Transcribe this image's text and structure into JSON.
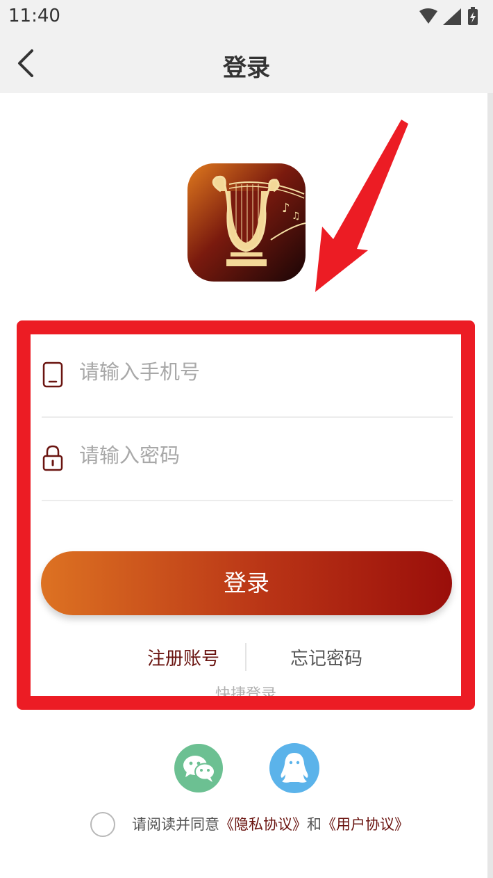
{
  "status_bar": {
    "time": "11:40"
  },
  "nav": {
    "title": "登录"
  },
  "form": {
    "phone_placeholder": "请输入手机号",
    "password_placeholder": "请输入密码",
    "login_label": "登录",
    "register_label": "注册账号",
    "forgot_label": "忘记密码",
    "quick_login_label": "快捷登录"
  },
  "agreement": {
    "prefix": "请阅读并同意",
    "privacy_link": "《隐私协议》",
    "conjunction": "和",
    "user_link": "《用户协议》"
  },
  "colors": {
    "accent_dark_red": "#6a1410",
    "button_gradient_start": "#dd7222",
    "button_gradient_end": "#9a0e0a",
    "annotation_red": "#ec1c24",
    "wechat_green": "#6cc092",
    "qq_blue": "#5bb3ea"
  },
  "icons": {
    "back": "chevron-left-icon",
    "wifi": "wifi-icon",
    "signal": "signal-icon",
    "battery": "battery-charging-icon",
    "phone": "phone-icon",
    "lock": "lock-icon",
    "wechat": "wechat-icon",
    "qq": "qq-icon"
  }
}
